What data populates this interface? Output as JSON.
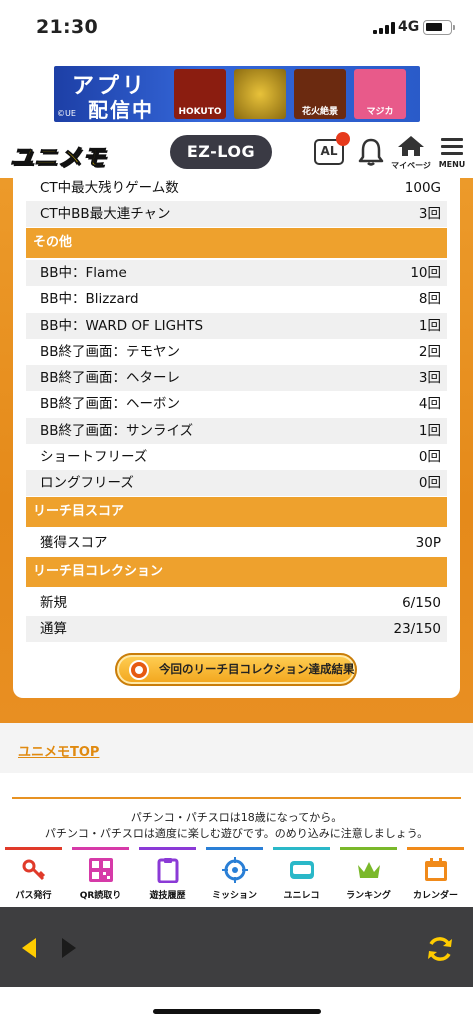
{
  "status": {
    "time": "21:30",
    "network": "4G"
  },
  "banner": {
    "line1": "アプリ",
    "line2": "配信中",
    "copyright": "©UE",
    "thumbs": [
      {
        "label": "HOKUTO",
        "bg": "#8b1d10"
      },
      {
        "label": "",
        "bg": "#a37a12"
      },
      {
        "label": "花火絶景",
        "bg": "#6b2a10"
      },
      {
        "label": "マジカ",
        "bg": "#e85a8a"
      }
    ]
  },
  "header": {
    "logo": "ユニメモ",
    "ezlog": "EZ-LOG",
    "al": "AL",
    "mypage": "マイページ",
    "menu": "MENU"
  },
  "colors": {
    "orange": "#eea12d",
    "accent": "#e08a10",
    "alert": "#e63a1c"
  },
  "top_rows": [
    {
      "label": "CT中最大残りゲーム数",
      "value": "100G"
    },
    {
      "label": "CT中BB最大連チャン",
      "value": "3回"
    }
  ],
  "sections": {
    "other": "その他",
    "reach_score": "リーチ目スコア",
    "reach_collection": "リーチ目コレクション"
  },
  "other_rows": [
    {
      "label": "BB中：Flame",
      "value": "10回"
    },
    {
      "label": "BB中：Blizzard",
      "value": "8回"
    },
    {
      "label": "BB中：WARD OF LIGHTS",
      "value": "1回"
    },
    {
      "label": "BB終了画面：テモヤン",
      "value": "2回"
    },
    {
      "label": "BB終了画面：ヘターレ",
      "value": "3回"
    },
    {
      "label": "BB終了画面：ヘーボン",
      "value": "4回"
    },
    {
      "label": "BB終了画面：サンライズ",
      "value": "1回"
    },
    {
      "label": "ショートフリーズ",
      "value": "0回"
    },
    {
      "label": "ロングフリーズ",
      "value": "0回"
    }
  ],
  "score_rows": [
    {
      "label": "獲得スコア",
      "value": "30P"
    }
  ],
  "collection_rows": [
    {
      "label": "新規",
      "value": "6/150"
    },
    {
      "label": "通算",
      "value": "23/150"
    }
  ],
  "achieve_button": "今回のリーチ目コレクション達成結果",
  "top_link": "ユニメモTOP",
  "notice": {
    "line1": "パチンコ・パチスロは18歳になってから。",
    "line2": "パチンコ・パチスロは適度に楽しむ遊びです。のめり込みに注意しましょう。"
  },
  "bottom_nav": [
    {
      "label": "パス発行",
      "icon": "key-icon",
      "color": "#e03a2a"
    },
    {
      "label": "QR読取り",
      "icon": "qr-code-icon",
      "color": "#d63aa8"
    },
    {
      "label": "遊技履歴",
      "icon": "clipboard-icon",
      "color": "#8b3ad6"
    },
    {
      "label": "ミッション",
      "icon": "target-icon",
      "color": "#2a7fd6"
    },
    {
      "label": "ユニレコ",
      "icon": "unireco-icon",
      "color": "#2ab8c8"
    },
    {
      "label": "ランキング",
      "icon": "crown-icon",
      "color": "#7ab82a"
    },
    {
      "label": "カレンダー",
      "icon": "calendar-icon",
      "color": "#f08a1a"
    }
  ]
}
